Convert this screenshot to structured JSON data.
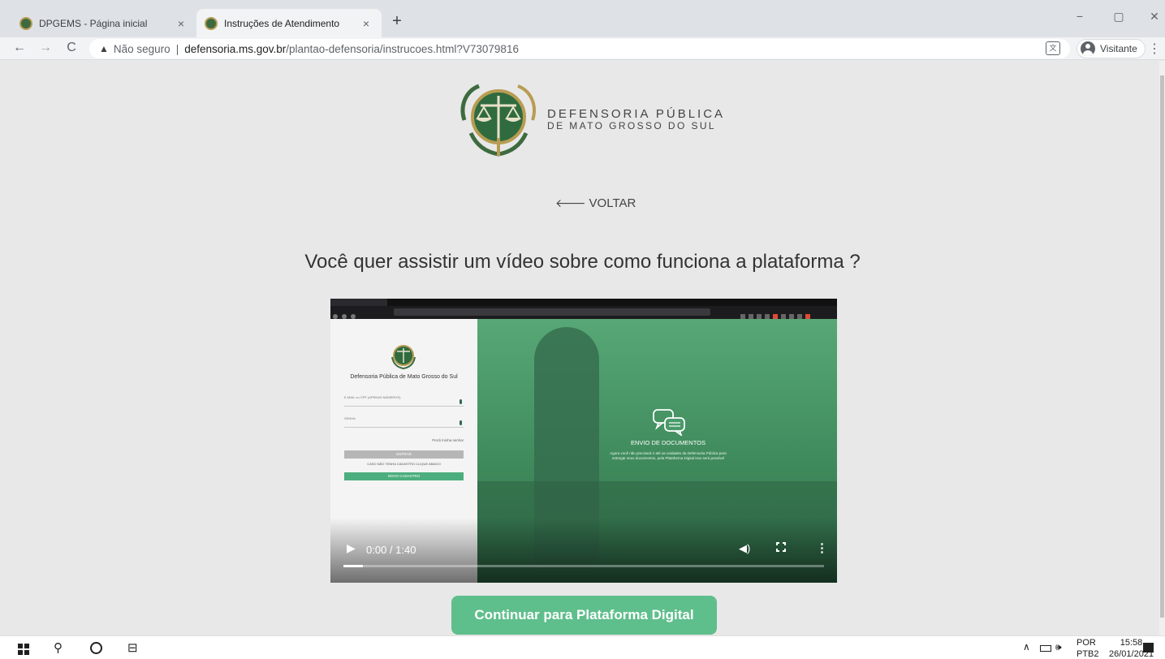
{
  "browser": {
    "tabs": [
      {
        "title": "DPGEMS - Página inicial",
        "close": "×",
        "active": false
      },
      {
        "title": "Instruções de Atendimento",
        "close": "×",
        "active": true
      }
    ],
    "new_tab": "+",
    "window_controls": {
      "minimize": "−",
      "maximize": "▢",
      "close": "✕"
    },
    "nav": {
      "back": "←",
      "forward": "→",
      "reload": "C"
    },
    "address": {
      "security_icon": "▲",
      "security_label": "Não seguro",
      "separator": "|",
      "domain": "defensoria.ms.gov.br",
      "path": "/plantao-defensoria/instrucoes.html?V73079816"
    },
    "profile_label": "Visitante",
    "menu": "⋮"
  },
  "page": {
    "logo": {
      "line1": "DEFENSORIA PÚBLICA",
      "line2": "DE MATO GROSSO DO SUL"
    },
    "back_link": {
      "arrow": "🡐",
      "label": "VOLTAR"
    },
    "heading": "Você quer assistir um vídeo sobre como funciona a plataforma ?",
    "video": {
      "embedded": {
        "org_name": "Defensoria Pública de Mato Grosso do Sul",
        "email_label": "E-MAIL ou CPF (APENAS NÚMEROS)",
        "password_label": "SENHA",
        "forgot": "Perdi minha senha!",
        "login_button": "ENTRAR",
        "divider": "CASO NÃO TENHA CADASTRO CLIQUE ABAIXO",
        "register_button": "NOVO CADASTRO",
        "message_title": "ENVIO DE DOCUMENTOS",
        "message_body": "Agora você não precisará ir até as unidades da Defensoria Pública para entregar seus documentos, pela Plataforma Digital isso será possível"
      },
      "controls": {
        "play": "▶",
        "time": "0:00 / 1:40",
        "volume": "◀)",
        "more": "⋮",
        "progress_fraction": 0.04
      }
    },
    "continue_button": "Continuar para Plataforma Digital"
  },
  "taskbar": {
    "search_icon": "⚲",
    "taskview_icon": "⊟",
    "tray": {
      "chevron": "∧",
      "speaker": "🕪",
      "lang_line1": "POR",
      "lang_line2": "PTB2",
      "time": "15:58",
      "date": "26/01/2021"
    }
  },
  "colors": {
    "accent_green": "#5fbf8c",
    "page_bg": "#e8e8e8",
    "logo_green": "#2f6b3f",
    "logo_gold": "#b89c52"
  }
}
